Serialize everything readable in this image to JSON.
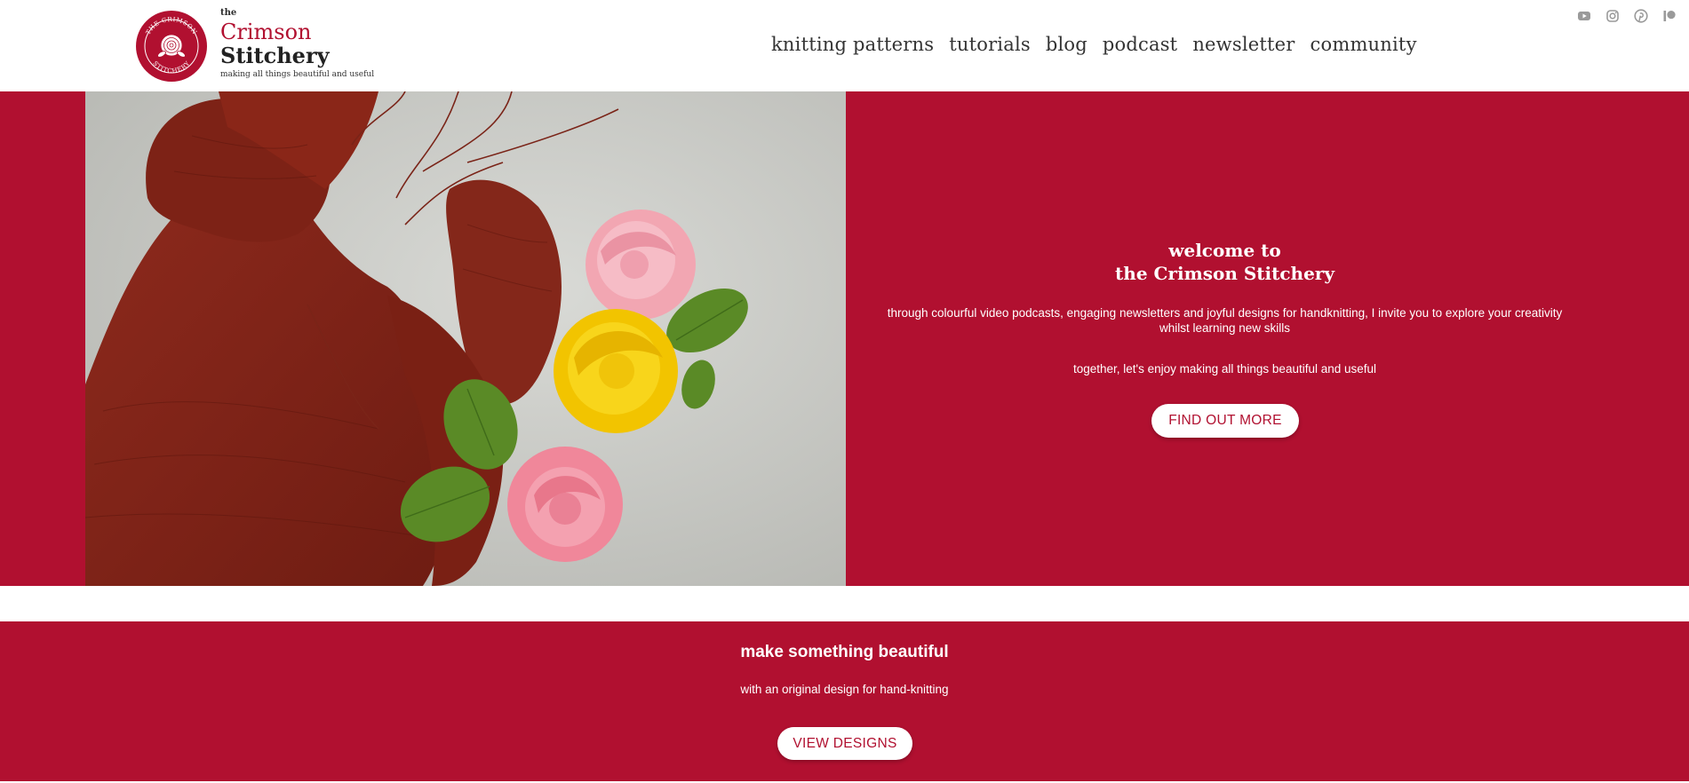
{
  "colors": {
    "brand_crimson": "#b11030",
    "white": "#ffffff",
    "nav_text": "#333333",
    "social_icon": "#9a9a9a"
  },
  "logo": {
    "the": "the",
    "name_line1": "Crimson",
    "name_line2": "Stitchery",
    "tagline": "making all things beautiful and useful",
    "badge_text_top": "THE CRIMSON",
    "badge_text_bottom": "STITCHERY",
    "icon": "rose-badge-icon"
  },
  "nav": {
    "items": [
      {
        "label": "knitting patterns"
      },
      {
        "label": "tutorials"
      },
      {
        "label": "blog"
      },
      {
        "label": "podcast"
      },
      {
        "label": "newsletter"
      },
      {
        "label": "community"
      }
    ]
  },
  "social": {
    "icons": [
      "youtube-icon",
      "instagram-icon",
      "pinterest-icon",
      "patreon-icon"
    ]
  },
  "hero": {
    "image_icon": "knitted-sweater-with-roses-photo",
    "heading_line1": "welcome to",
    "heading_line2": "the Crimson Stitchery",
    "text1": "through colourful video podcasts, engaging newsletters and joyful designs for handknitting, I invite you to explore your creativity whilst learning new skills",
    "text2": "together, let's enjoy making all things beautiful and useful",
    "button_label": "FIND OUT MORE"
  },
  "section2": {
    "title": "make something beautiful",
    "subtitle": "with an original design for hand-knitting",
    "button_label": "VIEW DESIGNS"
  }
}
